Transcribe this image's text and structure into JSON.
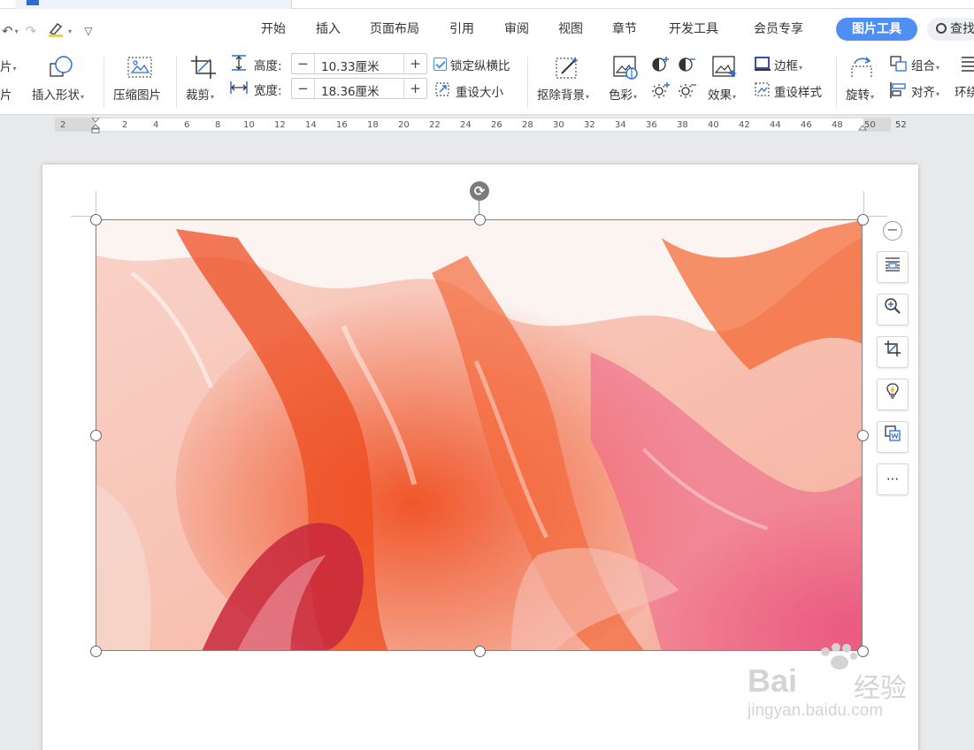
{
  "quick_access": {
    "undo": "↶",
    "redo": "↷",
    "more": "▽"
  },
  "menu": {
    "items": [
      "开始",
      "插入",
      "页面布局",
      "引用",
      "审阅",
      "视图",
      "章节",
      "开发工具",
      "会员专享"
    ],
    "active": "图片工具",
    "search": "查找"
  },
  "ribbon": {
    "cut_left_top": "片",
    "cut_left_bottom": "片",
    "insert_shape": "插入形状",
    "compress": "压缩图片",
    "crop": "裁剪",
    "height_label": "高度:",
    "height_value": "10.33厘米",
    "width_label": "宽度:",
    "width_value": "18.36厘米",
    "lock_ratio": "锁定纵横比",
    "reset_size": "重设大小",
    "remove_bg": "抠除背景",
    "color": "色彩",
    "effects": "效果",
    "border": "边框",
    "reset_style": "重设样式",
    "rotate": "旋转",
    "group": "组合",
    "align": "对齐",
    "wrap": "环绕",
    "minus": "−",
    "plus": "+"
  },
  "ruler": {
    "labels": [
      "2",
      "2",
      "4",
      "6",
      "8",
      "10",
      "12",
      "14",
      "16",
      "18",
      "20",
      "22",
      "24",
      "26",
      "28",
      "30",
      "32",
      "34",
      "36",
      "38",
      "40",
      "42",
      "44",
      "46",
      "48",
      "50",
      "52"
    ]
  },
  "side_tools": {
    "collapse": "−",
    "more": "···"
  },
  "watermark": {
    "brand_latin": "Bai",
    "brand_cn": "经验",
    "url": "jingyan.baidu.com"
  },
  "colors": {
    "accent": "#4f8ef3",
    "paint_orange": "#f0562a",
    "paint_pink": "#e8507a",
    "paint_red": "#c8283c"
  }
}
